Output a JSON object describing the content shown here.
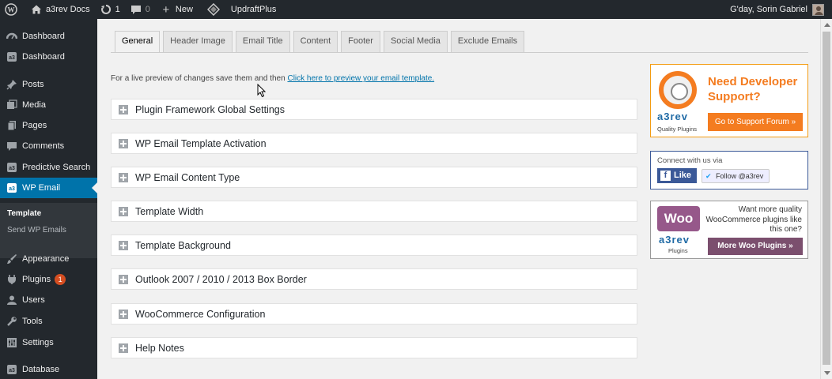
{
  "adminbar": {
    "site_name": "a3rev Docs",
    "updates_count": "1",
    "comments_count": "0",
    "new_label": "New",
    "plugin_link": "UpdraftPlus",
    "greeting": "G'day, Sorin Gabriel"
  },
  "sidebar": {
    "items": [
      {
        "label": "Dashboard",
        "icon": "speedometer-icon"
      },
      {
        "label": "Dashboard",
        "icon": "a3-icon"
      },
      {
        "label": "Posts",
        "icon": "pin-icon"
      },
      {
        "label": "Media",
        "icon": "media-icon"
      },
      {
        "label": "Pages",
        "icon": "pages-icon"
      },
      {
        "label": "Comments",
        "icon": "comments-icon"
      },
      {
        "label": "Predictive Search",
        "icon": "a3-icon"
      },
      {
        "label": "WP Email",
        "icon": "a3-icon"
      },
      {
        "label": "Appearance",
        "icon": "brush-icon"
      },
      {
        "label": "Plugins",
        "icon": "plug-icon",
        "badge": "1"
      },
      {
        "label": "Users",
        "icon": "user-icon"
      },
      {
        "label": "Tools",
        "icon": "wrench-icon"
      },
      {
        "label": "Settings",
        "icon": "settings-icon"
      },
      {
        "label": "Database",
        "icon": "database-icon"
      }
    ],
    "submenu": [
      "Template",
      "Send WP Emails"
    ]
  },
  "tabs": [
    "General",
    "Header Image",
    "Email Title",
    "Content",
    "Footer",
    "Social Media",
    "Exclude Emails"
  ],
  "preview": {
    "text": "For a live preview of changes save them and then",
    "link": "Click here to preview your email template."
  },
  "panels": [
    "Plugin Framework Global Settings",
    "WP Email Template Activation",
    "WP Email Content Type",
    "Template Width",
    "Template Background",
    "Outlook 2007 / 2010 / 2013 Box Border",
    "WooCommerce Configuration",
    "Help Notes"
  ],
  "widgets": {
    "support": {
      "headline_1": "Need Developer",
      "headline_2": "Support?",
      "logo": "a3rev",
      "logo_sub": "Quality Plugins",
      "button": "Go to Support Forum »"
    },
    "social": {
      "connect": "Connect with us via",
      "like": "Like",
      "follow": "Follow @a3rev"
    },
    "woo": {
      "logo": "Woo",
      "logo2": "a3rev",
      "logo_sub": "Plugins",
      "blurb": "Want more quality WooCommerce plugins like this one?",
      "button": "More Woo Plugins »"
    }
  },
  "colors": {
    "admin_dark": "#23282d",
    "active_blue": "#0073aa",
    "orange": "#f47c20",
    "woo_purple": "#7b4f6e"
  }
}
